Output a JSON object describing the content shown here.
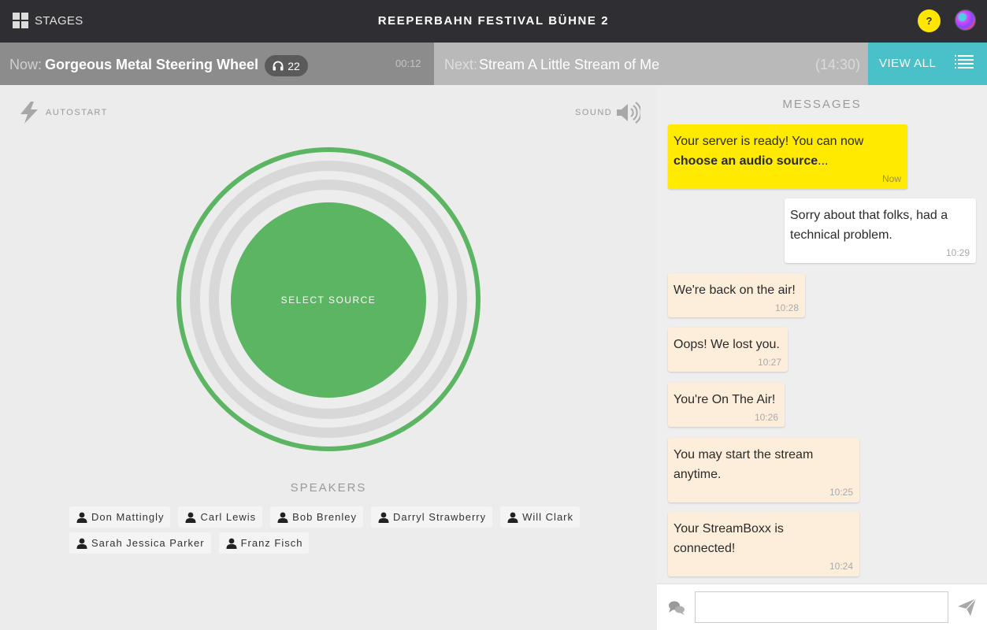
{
  "topbar": {
    "stages_label": "STAGES",
    "stage_title": "REEPERBAHN FESTIVAL BÜHNE 2",
    "help_label": "?"
  },
  "now": {
    "prefix": "Now:",
    "title": "Gorgeous Metal Steering Wheel",
    "listeners": "22",
    "time": "00:12"
  },
  "next": {
    "prefix": "Next:",
    "title": "Stream A Little Stream of Me",
    "time": "(14:30)"
  },
  "viewall": {
    "label": "VIEW ALL"
  },
  "controls": {
    "autostart_label": "AUTOSTART",
    "sound_label": "SOUND",
    "select_source_label": "SELECT SOURCE"
  },
  "speakers": {
    "title": "SPEAKERS",
    "items": [
      "Don Mattingly",
      "Carl Lewis",
      "Bob Brenley",
      "Darryl Strawberry",
      "Will Clark",
      "Sarah Jessica Parker",
      "Franz Fisch"
    ]
  },
  "messages": {
    "title": "MESSAGES",
    "items": [
      {
        "text_before": "Your server is ready! You can now ",
        "text_bold": "choose an audio source",
        "text_after": "...",
        "time": "Now"
      },
      {
        "text": "Sorry about that folks, had a technical problem.",
        "time": "10:29"
      },
      {
        "text": "We're back on the air!",
        "time": "10:28"
      },
      {
        "text": "Oops! We lost you.",
        "time": "10:27"
      },
      {
        "text": "You're On The Air!",
        "time": "10:26"
      },
      {
        "text": "You may start the stream anytime.",
        "time": "10:25"
      },
      {
        "text": "Your StreamBoxx is connected!",
        "time": "10:24"
      }
    ],
    "input_value": ""
  },
  "colors": {
    "accent_green": "#5cb562",
    "accent_teal": "#4ac1c8",
    "highlight_yellow": "#ffea00",
    "message_beige": "#fdeedb"
  }
}
